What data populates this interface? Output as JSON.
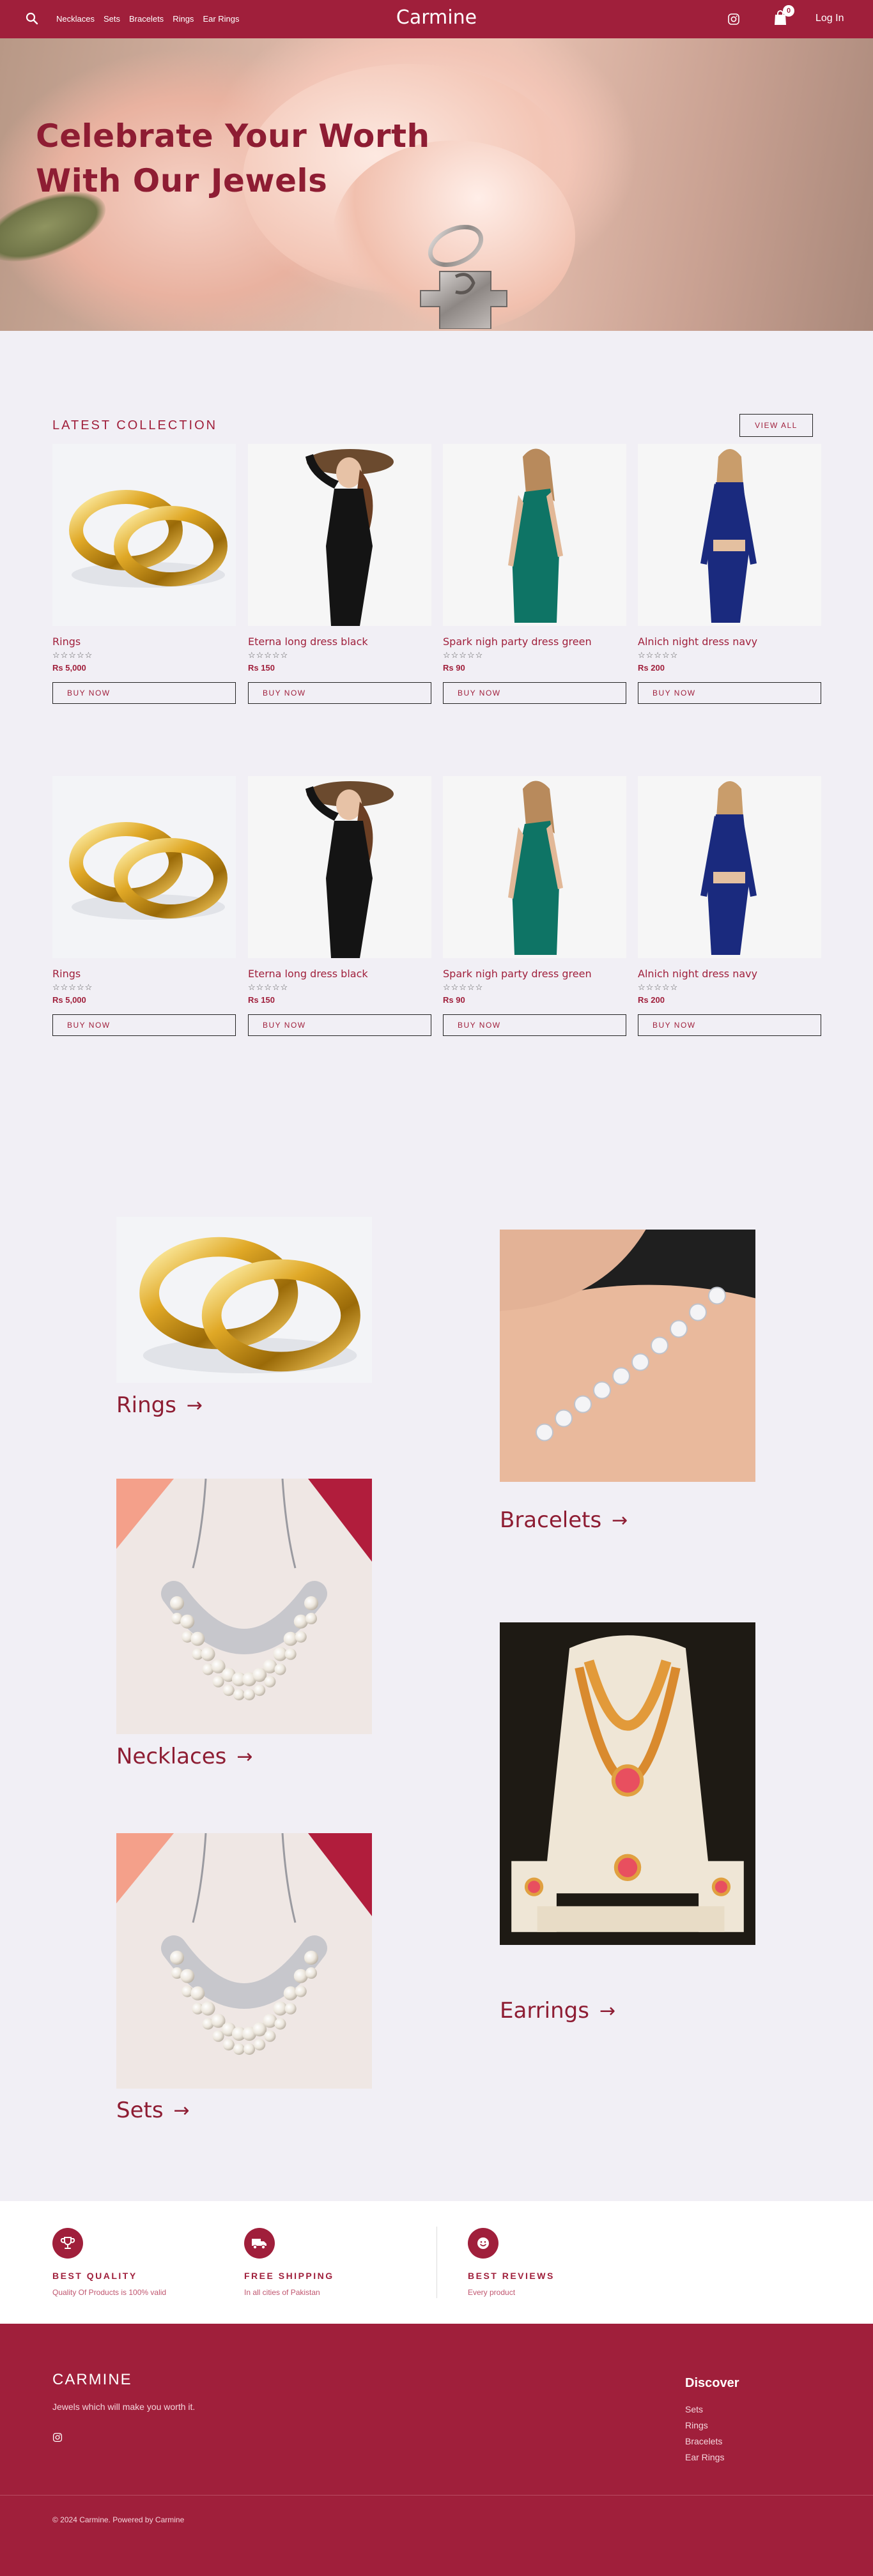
{
  "header": {
    "nav": [
      "Necklaces",
      "Sets",
      "Bracelets",
      "Rings",
      "Ear Rings"
    ],
    "brand": "Carmine",
    "cart_count": "0",
    "login": "Log In"
  },
  "hero": {
    "title": "Celebrate Your Worth With Our Jewels"
  },
  "latest": {
    "title": "LATEST COLLECTION",
    "view_all": "VIEW ALL",
    "stars": "☆☆☆☆☆",
    "buy_label": "BUY NOW",
    "products": [
      {
        "name": "Rings",
        "price": "Rs 5,000",
        "image": "gold-rings"
      },
      {
        "name": "Eterna long dress black",
        "price": "Rs 150",
        "image": "black-dress"
      },
      {
        "name": "Spark nigh party dress green",
        "price": "Rs 90",
        "image": "green-dress"
      },
      {
        "name": "Alnich night dress navy",
        "price": "Rs 200",
        "image": "navy-dress"
      },
      {
        "name": "Rings",
        "price": "Rs 5,000",
        "image": "gold-rings"
      },
      {
        "name": "Eterna long dress black",
        "price": "Rs 150",
        "image": "black-dress"
      },
      {
        "name": "Spark nigh party dress green",
        "price": "Rs 90",
        "image": "green-dress"
      },
      {
        "name": "Alnich night dress navy",
        "price": "Rs 200",
        "image": "navy-dress"
      }
    ]
  },
  "categories": {
    "arrow": "→",
    "items": [
      {
        "label": "Rings",
        "image": "gold-rings"
      },
      {
        "label": "Bracelets",
        "image": "bracelet"
      },
      {
        "label": "Necklaces",
        "image": "pearl-necklace"
      },
      {
        "label": "Earrings",
        "image": "gold-set"
      },
      {
        "label": "Sets",
        "image": "pearl-necklace"
      }
    ]
  },
  "features": [
    {
      "title": "BEST QUALITY",
      "desc": "Quality Of Products is 100% valid",
      "icon": "trophy-icon"
    },
    {
      "title": "FREE SHIPPING",
      "desc": "In all cities of Pakistan",
      "icon": "truck-icon"
    },
    {
      "title": "BEST REVIEWS",
      "desc": "Every product",
      "icon": "smile-icon"
    }
  ],
  "footer": {
    "brand": "CARMINE",
    "tagline": "Jewels which will make you worth it.",
    "discover_title": "Discover",
    "links": [
      "Sets",
      "Rings",
      "Bracelets",
      "Ear Rings"
    ],
    "copyright": "© 2024 Carmine. Powered by Carmine"
  },
  "colors": {
    "brand": "#a01f3b",
    "background": "#f1eff5"
  }
}
